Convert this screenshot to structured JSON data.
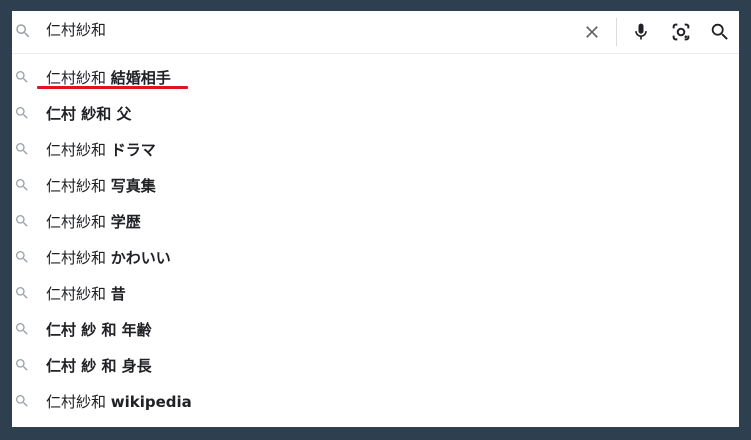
{
  "search": {
    "query": "仁村紗和"
  },
  "icons": {
    "search": "search-icon",
    "clear": "close-icon",
    "voice": "microphone-icon",
    "lens": "camera-lens-icon",
    "submit": "search-icon"
  },
  "colors": {
    "backdrop": "#2e4050",
    "highlight": "#e0141e"
  },
  "suggestions": [
    {
      "prefix": "仁村紗和",
      "bold": "結婚相手"
    },
    {
      "prefix": "",
      "bold": "仁村 紗和 父"
    },
    {
      "prefix": "仁村紗和",
      "bold": "ドラマ"
    },
    {
      "prefix": "仁村紗和",
      "bold": "写真集"
    },
    {
      "prefix": "仁村紗和",
      "bold": "学歴"
    },
    {
      "prefix": "仁村紗和",
      "bold": "かわいい"
    },
    {
      "prefix": "仁村紗和",
      "bold": "昔"
    },
    {
      "prefix": "",
      "bold": "仁村 紗 和 年齢"
    },
    {
      "prefix": "",
      "bold": "仁村 紗 和 身長"
    },
    {
      "prefix": "仁村紗和",
      "bold": "wikipedia"
    }
  ]
}
